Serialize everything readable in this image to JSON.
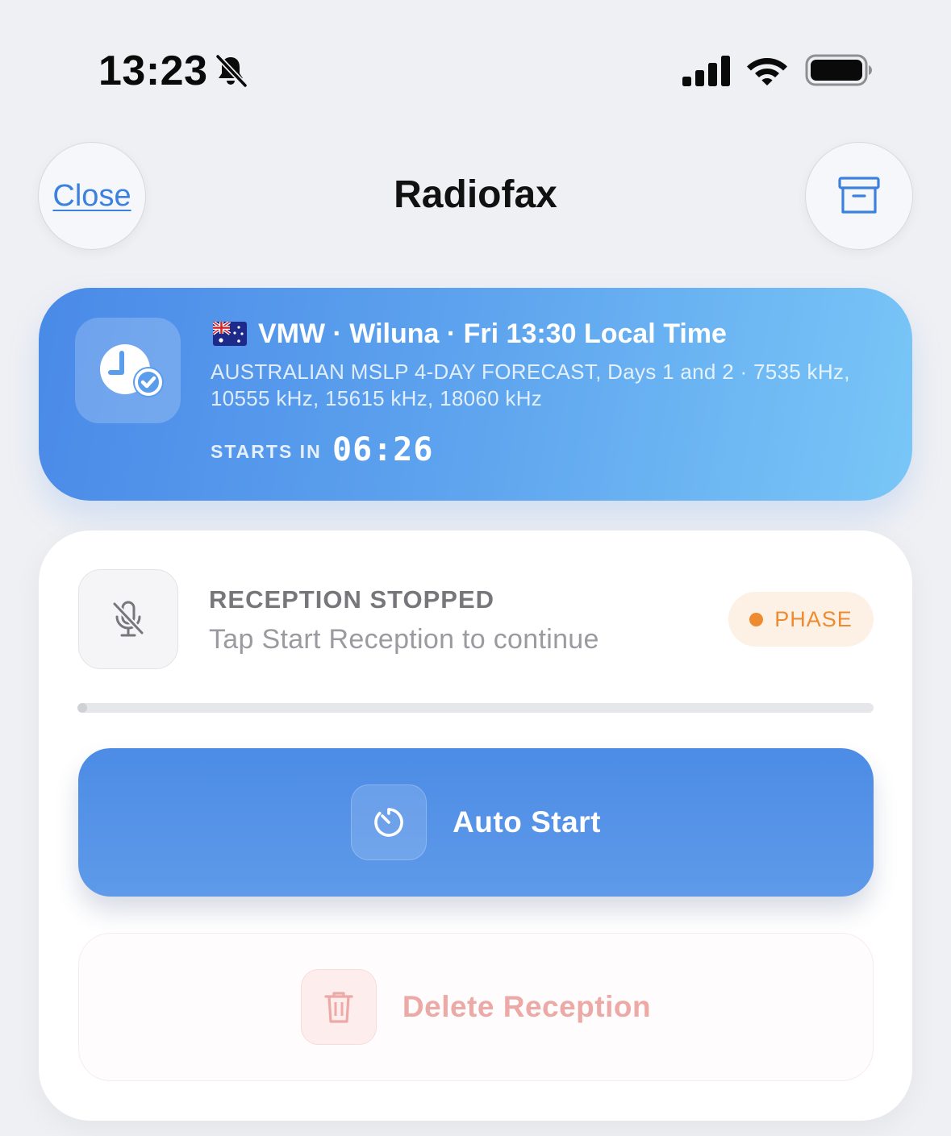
{
  "status_bar": {
    "time": "13:23",
    "icons": [
      "bell-slash-icon",
      "cellular-signal-icon",
      "wifi-icon",
      "battery-icon"
    ]
  },
  "nav": {
    "close_label": "Close",
    "title": "Radiofax",
    "archive_icon": "archive-box-icon"
  },
  "schedule": {
    "icon": "clock-checkmark-icon",
    "flag": "australia-flag",
    "title": "VMW · Wiluna · Fri 13:30 Local Time",
    "subtitle": "AUSTRALIAN MSLP 4-DAY FORECAST, Days 1 and 2 · 7535 kHz, 10555 kHz, 15615 kHz, 18060 kHz",
    "starts_in_label": "STARTS IN",
    "countdown": "06:26"
  },
  "reception": {
    "icon": "microphone-slash-icon",
    "status": "RECEPTION STOPPED",
    "hint": "Tap Start Reception to continue",
    "badge": "PHASE",
    "progress": 0.0,
    "auto_start": {
      "label": "Auto Start",
      "icon": "timer-icon"
    },
    "delete": {
      "label": "Delete Reception",
      "icon": "trash-icon"
    }
  },
  "colors": {
    "accent": "#4a8ae8",
    "badge_orange": "#ee8a2f",
    "delete_red": "#eca9a6"
  }
}
